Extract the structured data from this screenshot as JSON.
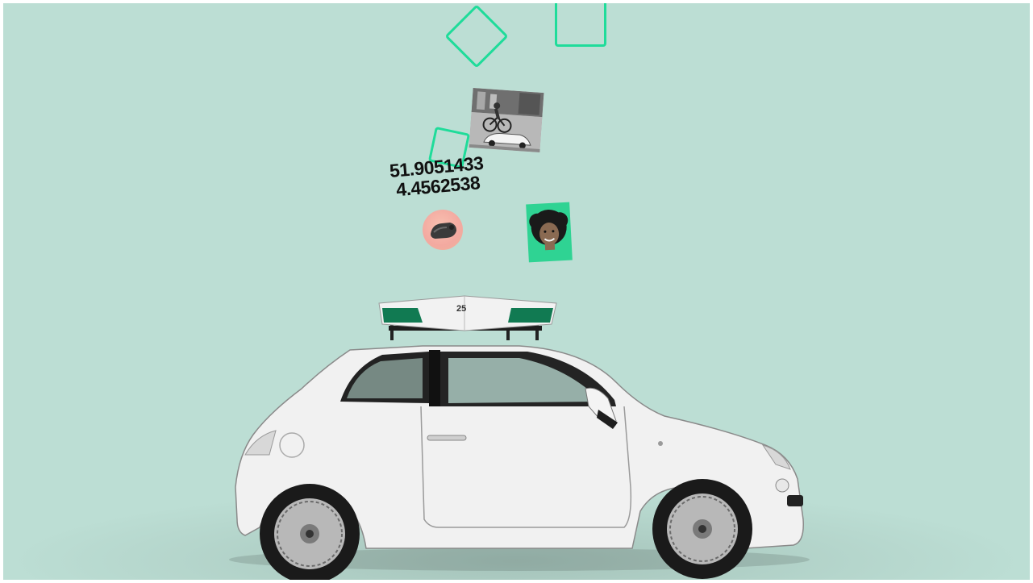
{
  "scene": {
    "background_color": "#bcded4",
    "accent_color": "#1fdc9a",
    "coordinates": {
      "latitude": "51.9051433",
      "longitude": "4.4562538"
    },
    "roof_unit_number": "25"
  }
}
